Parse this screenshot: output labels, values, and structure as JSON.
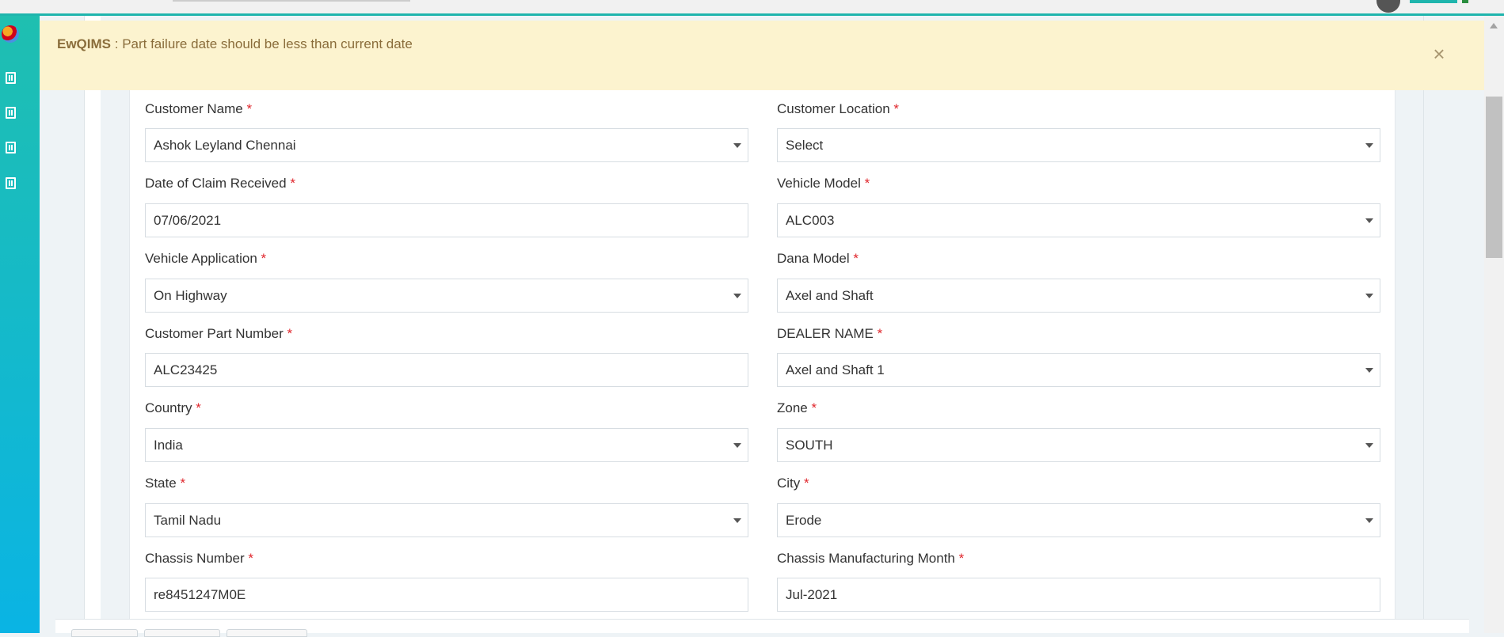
{
  "alert": {
    "brand": "EwQIMS",
    "separator": " : ",
    "message": "Part failure date should be less than current date",
    "close_label": "×"
  },
  "required_mark": "*",
  "fields": {
    "customer_name": {
      "label": "Customer Name",
      "value": "Ashok Leyland Chennai"
    },
    "customer_location": {
      "label": "Customer Location",
      "value": "Select"
    },
    "date_claim_received": {
      "label": "Date of Claim Received",
      "value": "07/06/2021"
    },
    "vehicle_model": {
      "label": "Vehicle Model",
      "value": "ALC003"
    },
    "vehicle_application": {
      "label": "Vehicle Application",
      "value": "On Highway"
    },
    "dana_model": {
      "label": "Dana Model",
      "value": "Axel and Shaft"
    },
    "customer_part_number": {
      "label": "Customer Part Number",
      "value": "ALC23425"
    },
    "dealer_name": {
      "label": "DEALER NAME",
      "value": "Axel and Shaft 1"
    },
    "country": {
      "label": "Country",
      "value": "India"
    },
    "zone": {
      "label": "Zone",
      "value": "SOUTH"
    },
    "state": {
      "label": "State",
      "value": "Tamil Nadu"
    },
    "city": {
      "label": "City",
      "value": "Erode"
    },
    "chassis_number": {
      "label": "Chassis Number",
      "value": "re8451247M0E"
    },
    "chassis_mfg_month": {
      "label": "Chassis Manufacturing Month",
      "value": "Jul-2021"
    }
  }
}
